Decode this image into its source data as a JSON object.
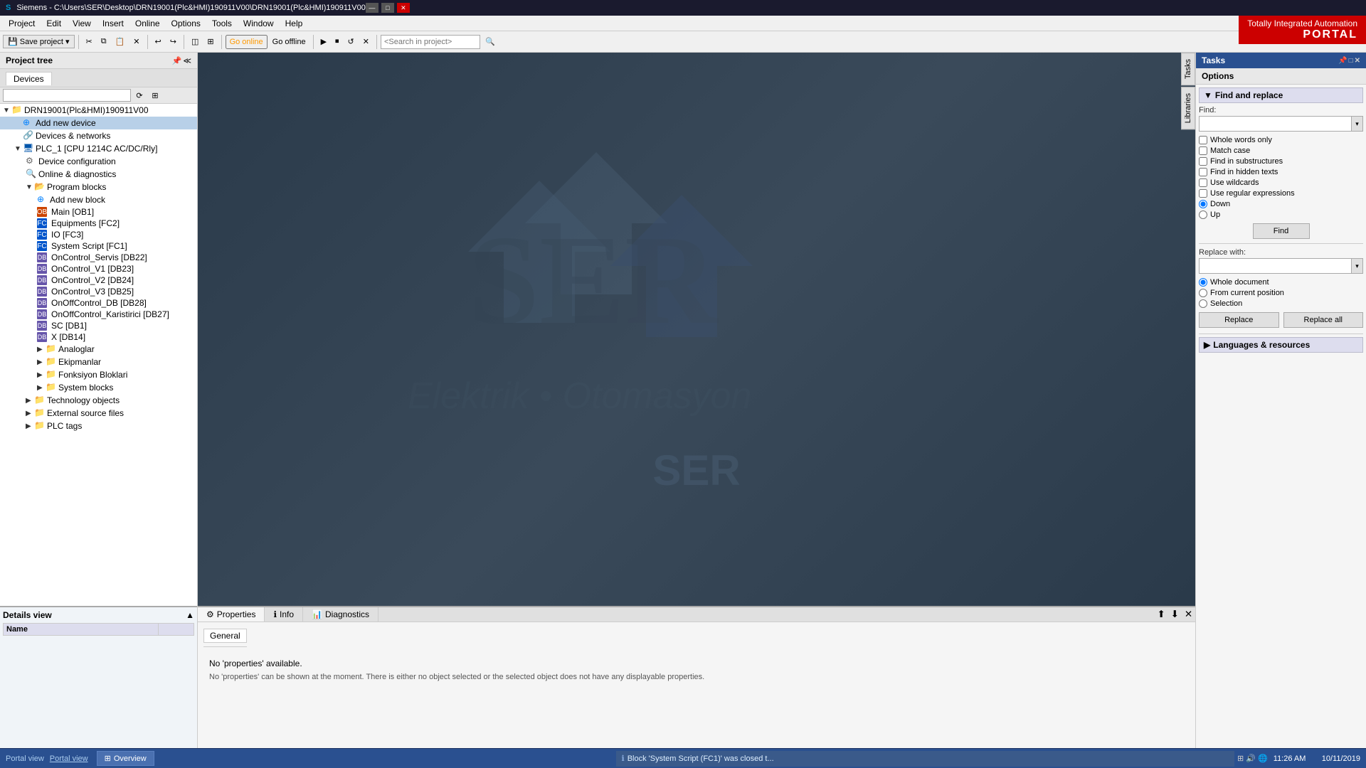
{
  "titlebar": {
    "title": "Siemens  -  C:\\Users\\SER\\Desktop\\DRN19001(Plc&HMI)190911V00\\DRN19001(Plc&HMI)190911V00",
    "minimize": "—",
    "maximize": "□",
    "close": "✕"
  },
  "branding": {
    "line1": "Totally Integrated Automation",
    "line2": "PORTAL"
  },
  "menubar": {
    "items": [
      "Project",
      "Edit",
      "View",
      "Insert",
      "Online",
      "Options",
      "Tools",
      "Window",
      "Help"
    ]
  },
  "toolbar": {
    "save_project": "Save project",
    "go_online": "Go online",
    "go_offline": "Go offline",
    "search_placeholder": "<Search in project>"
  },
  "project_tree": {
    "header": "Project tree",
    "devices_tab": "Devices",
    "root_node": "DRN19001(Plc&HMI)190911V00",
    "items": [
      {
        "label": "Add new device",
        "type": "add",
        "level": 1
      },
      {
        "label": "Devices & networks",
        "type": "folder",
        "level": 1
      },
      {
        "label": "PLC_1 [CPU 1214C AC/DC/Rly]",
        "type": "plc",
        "level": 1,
        "expanded": true
      },
      {
        "label": "Device configuration",
        "type": "device",
        "level": 2
      },
      {
        "label": "Online & diagnostics",
        "type": "diag",
        "level": 2
      },
      {
        "label": "Program blocks",
        "type": "folder",
        "level": 2,
        "expanded": true
      },
      {
        "label": "Add new block",
        "type": "add",
        "level": 3
      },
      {
        "label": "Main [OB1]",
        "type": "block_ob",
        "level": 3
      },
      {
        "label": "Equipments [FC2]",
        "type": "block_fc",
        "level": 3
      },
      {
        "label": "IO [FC3]",
        "type": "block_fc",
        "level": 3
      },
      {
        "label": "System Script [FC1]",
        "type": "block_fc",
        "level": 3
      },
      {
        "label": "OnControl_Servis [DB22]",
        "type": "block_db",
        "level": 3
      },
      {
        "label": "OnControl_V1 [DB23]",
        "type": "block_db",
        "level": 3
      },
      {
        "label": "OnControl_V2 [DB24]",
        "type": "block_db",
        "level": 3
      },
      {
        "label": "OnControl_V3 [DB25]",
        "type": "block_db",
        "level": 3
      },
      {
        "label": "OnOffControl_DB [DB28]",
        "type": "block_db",
        "level": 3
      },
      {
        "label": "OnOffControl_Karistirici [DB27]",
        "type": "block_db",
        "level": 3
      },
      {
        "label": "SC [DB1]",
        "type": "block_db",
        "level": 3
      },
      {
        "label": "X [DB14]",
        "type": "block_db",
        "level": 3
      },
      {
        "label": "Analoglar",
        "type": "folder",
        "level": 3
      },
      {
        "label": "Ekipmanlar",
        "type": "folder",
        "level": 3
      },
      {
        "label": "Fonksiyon Bloklari",
        "type": "folder",
        "level": 3
      },
      {
        "label": "System blocks",
        "type": "folder",
        "level": 3
      },
      {
        "label": "Technology objects",
        "type": "folder",
        "level": 2
      },
      {
        "label": "External source files",
        "type": "folder",
        "level": 2
      },
      {
        "label": "PLC tags",
        "type": "folder",
        "level": 2
      }
    ]
  },
  "details_view": {
    "header": "Details view",
    "columns": [
      "Name",
      ""
    ]
  },
  "canvas": {
    "watermark1": "Elektrik • Otomasyon",
    "watermark2": "SER"
  },
  "bottom_panel": {
    "tabs": [
      "Properties",
      "Info",
      "Diagnostics"
    ],
    "active_tab": "Properties",
    "general_tab": "General",
    "no_props_title": "No 'properties' available.",
    "no_props_desc": "No 'properties' can be shown at the moment. There is either no object selected or the selected object does not have any displayable properties."
  },
  "right_panel": {
    "tasks_label": "Tasks",
    "options_label": "Options",
    "find_replace": {
      "header": "Find and replace",
      "find_label": "Find:",
      "find_value": "",
      "whole_words_only": "Whole words only",
      "match_case": "Match case",
      "find_in_substructures": "Find in substructures",
      "find_in_hidden_texts": "Find in hidden texts",
      "use_wildcards": "Use wildcards",
      "use_regular_expressions": "Use regular expressions",
      "direction_down": "Down",
      "direction_up": "Up",
      "find_btn": "Find",
      "replace_with_label": "Replace with:",
      "replace_value": "",
      "whole_document": "Whole document",
      "from_current_position": "From current position",
      "selection": "Selection",
      "replace_btn": "Replace",
      "replace_all_btn": "Replace all"
    },
    "languages_resources": "Languages & resources"
  },
  "statusbar": {
    "portal_view": "Portal view",
    "overview": "Overview",
    "status_icon": "ℹ",
    "status_msg": "Block 'System Script (FC1)' was closed t...",
    "clock": "11:26 AM",
    "date": "10/11/2019",
    "sys_tray_icons": "⊞ 🔊 🌐"
  }
}
